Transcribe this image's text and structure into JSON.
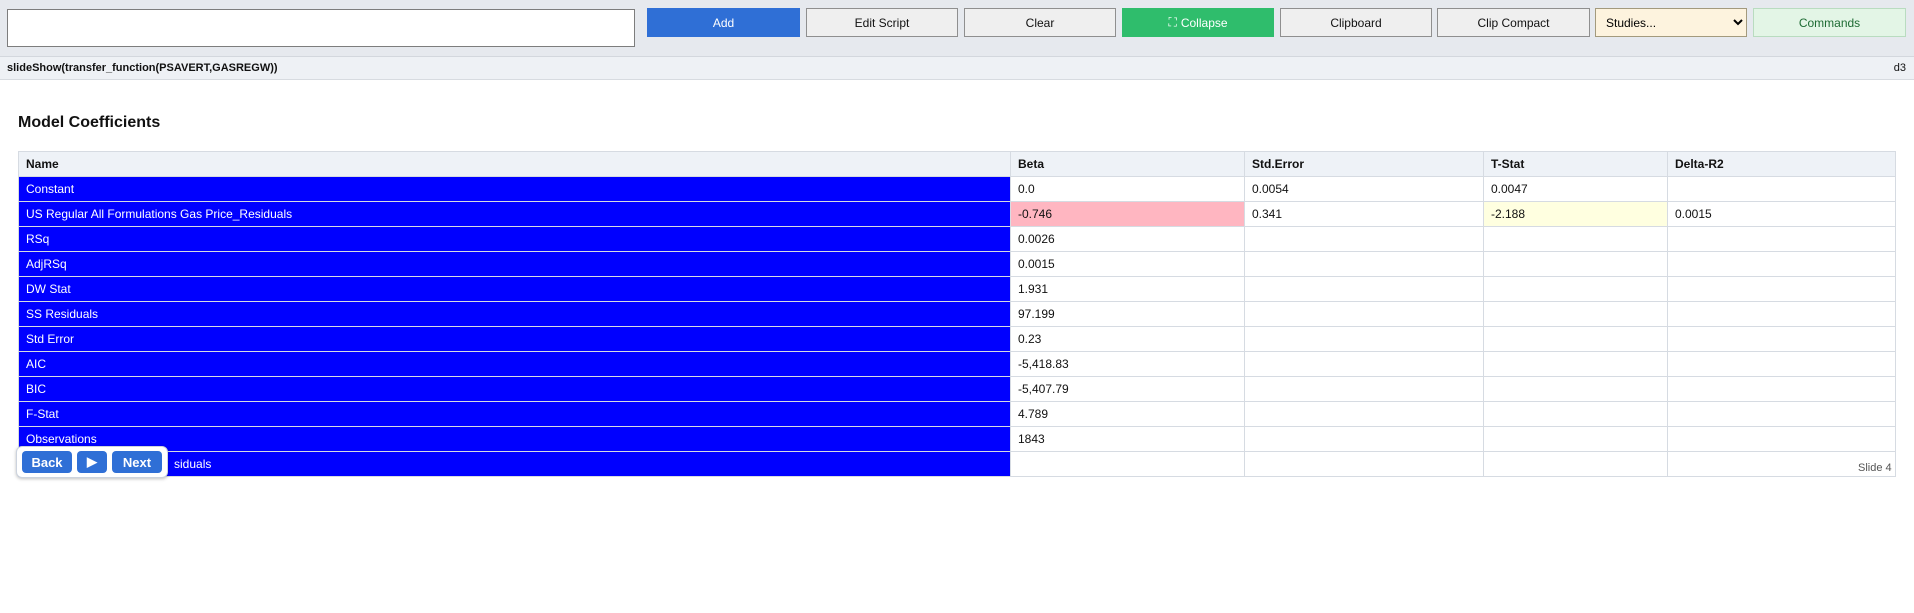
{
  "toolbar": {
    "command_input_value": "",
    "add_label": "Add",
    "edit_script_label": "Edit Script",
    "clear_label": "Clear",
    "collapse_icon": "collapse-arrows-icon",
    "collapse_label": "Collapse",
    "clipboard_label": "Clipboard",
    "clip_compact_label": "Clip Compact",
    "studies_selected": "Studies...",
    "commands_label": "Commands"
  },
  "script_bar": {
    "script": "slideShow(transfer_function(PSAVERT,GASREGW))",
    "id": "d3"
  },
  "section": {
    "title": "Model Coefficients"
  },
  "table": {
    "headers": [
      "Name",
      "Beta",
      "Std.Error",
      "T-Stat",
      "Delta-R2"
    ],
    "rows": [
      [
        "Constant",
        "0.0",
        "0.0054",
        "0.0047",
        ""
      ],
      [
        "US Regular All Formulations Gas Price_Residuals",
        "-0.746",
        "0.341",
        "-2.188",
        "0.0015"
      ],
      [
        "RSq",
        "0.0026",
        "",
        "",
        ""
      ],
      [
        "AdjRSq",
        "0.0015",
        "",
        "",
        ""
      ],
      [
        "DW Stat",
        "1.931",
        "",
        "",
        ""
      ],
      [
        "SS Residuals",
        "97.199",
        "",
        "",
        ""
      ],
      [
        "Std Error",
        "0.23",
        "",
        "",
        ""
      ],
      [
        "AIC",
        "-5,418.83",
        "",
        "",
        ""
      ],
      [
        "BIC",
        "-5,407.79",
        "",
        "",
        ""
      ],
      [
        "F-Stat",
        "4.789",
        "",
        "",
        ""
      ],
      [
        "Observations",
        "1843",
        "",
        "",
        ""
      ],
      [
        "siduals",
        "",
        "",
        "",
        ""
      ]
    ]
  },
  "slide": {
    "label": "Slide 4",
    "back_label": "Back",
    "play_icon": "play-icon",
    "play_symbol": "▶",
    "next_label": "Next"
  },
  "colors": {
    "name_cell_bg": "#0000ff",
    "negative_highlight": "#ffb6c1",
    "tstat_highlight": "#ffffe0",
    "primary": "#2f6fd6",
    "success": "#2fbd6c"
  }
}
